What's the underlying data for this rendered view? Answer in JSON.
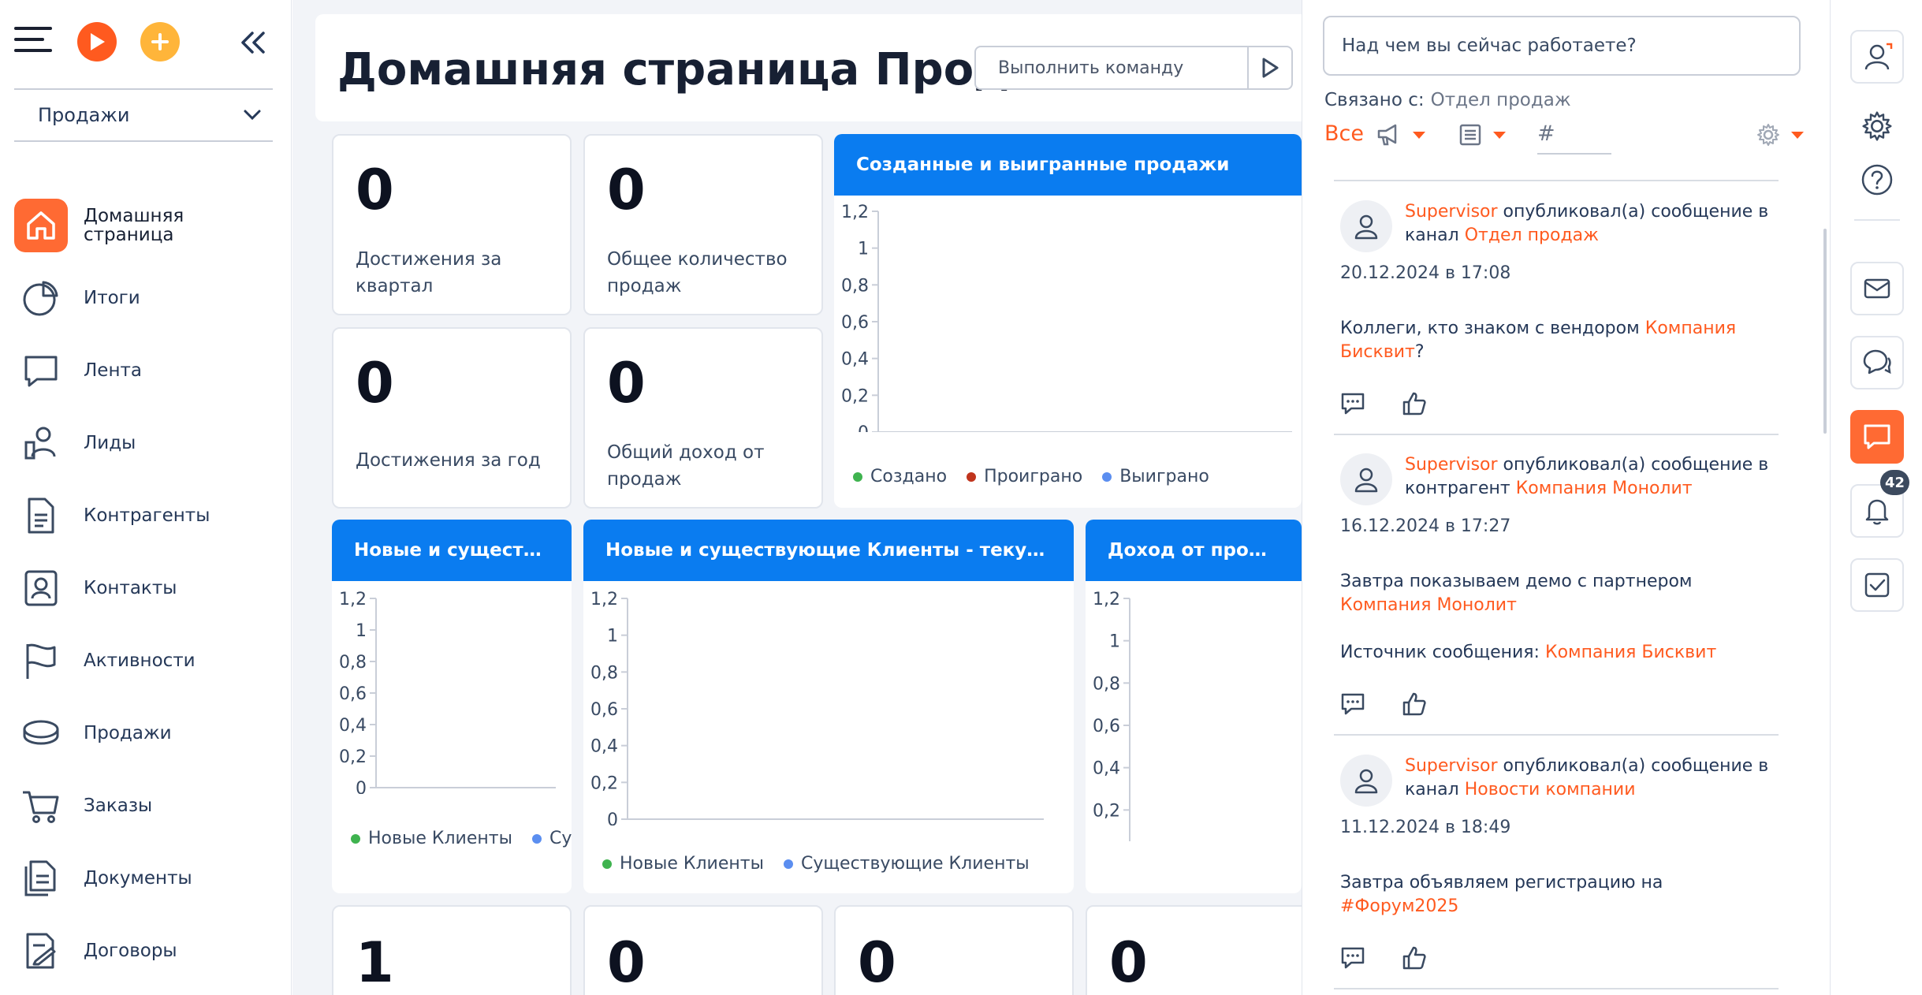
{
  "sidebar": {
    "workspace": "Продажи",
    "items": [
      {
        "label": "Домашняя страница",
        "icon": "home-icon",
        "active": true
      },
      {
        "label": "Итоги",
        "icon": "pie-chart-icon"
      },
      {
        "label": "Лента",
        "icon": "chat-bubble-icon"
      },
      {
        "label": "Лиды",
        "icon": "lead-icon"
      },
      {
        "label": "Контрагенты",
        "icon": "document-icon"
      },
      {
        "label": "Контакты",
        "icon": "contact-card-icon"
      },
      {
        "label": "Активности",
        "icon": "flag-icon"
      },
      {
        "label": "Продажи",
        "icon": "coin-icon"
      },
      {
        "label": "Заказы",
        "icon": "cart-icon"
      },
      {
        "label": "Документы",
        "icon": "documents-icon"
      },
      {
        "label": "Договоры",
        "icon": "contract-icon"
      }
    ]
  },
  "header": {
    "title": "Домашняя страница Продажи",
    "command_placeholder": "Выполнить команду"
  },
  "kpis": [
    {
      "value": "0",
      "label": "Достижения за квартал"
    },
    {
      "value": "0",
      "label": "Общее количество продаж"
    },
    {
      "value": "0",
      "label": "Достижения за год"
    },
    {
      "value": "0",
      "label": "Общий доход от продаж"
    }
  ],
  "bottom_kpis": [
    "1",
    "0",
    "0",
    "0"
  ],
  "charts": {
    "created_won": {
      "title": "Созданные и выигранные продажи",
      "legend": [
        {
          "name": "Создано",
          "color": "#3fb34f"
        },
        {
          "name": "Проиграно",
          "color": "#c0341d"
        },
        {
          "name": "Выиграно",
          "color": "#5b8ef0"
        }
      ]
    },
    "new_existing_short": {
      "title": "Новые и существую…",
      "legend": [
        {
          "name": "Новые Клиенты",
          "color": "#3fb34f"
        },
        {
          "name": "Существующие Клиент",
          "color": "#5b8ef0"
        }
      ]
    },
    "new_existing_year": {
      "title": "Новые и существующие Клиенты - текущий год",
      "legend": [
        {
          "name": "Новые Клиенты",
          "color": "#3fb34f"
        },
        {
          "name": "Существующие Клиенты",
          "color": "#5b8ef0"
        }
      ]
    },
    "revenue": {
      "title": "Доход от продаж в р…"
    }
  },
  "chart_data": {
    "type": "bar",
    "ylim": [
      0,
      1.2
    ],
    "y_ticks": [
      "1,2",
      "1",
      "0,8",
      "0,6",
      "0,4",
      "0,2",
      "0"
    ]
  },
  "feed": {
    "input_placeholder": "Над чем вы сейчас работаете?",
    "related_label": "Связано с:",
    "related_value": "Отдел продаж",
    "filter_all": "Все",
    "hash": "#",
    "posts": [
      {
        "author": "Supervisor",
        "action": " опубликовал(а) сообщение в канал ",
        "target": "Отдел продаж",
        "date": "20.12.2024 в 17:08",
        "text_before": "Коллеги, кто знаком с вендором ",
        "text_link": "Компания Бисквит",
        "text_after": "?"
      },
      {
        "author": "Supervisor",
        "action": " опубликовал(а) сообщение в контрагент ",
        "target": "Компания Монолит",
        "date": "16.12.2024 в 17:27",
        "text_before": "Завтра показываем демо с партнером ",
        "text_link": "Компания Монолит",
        "text_after": "",
        "source_label": "Источник сообщения: ",
        "source_link": "Компания Бисквит"
      },
      {
        "author": "Supervisor",
        "action": " опубликовал(а) сообщение в канал ",
        "target": "Новости компании",
        "date": "11.12.2024 в 18:49",
        "text_before": "Завтра объявляем регистрацию на ",
        "text_link": "#Форум2025",
        "text_after": ""
      }
    ]
  },
  "rail": {
    "notifications_count": "42"
  },
  "colors": {
    "accent": "#ff5a1f",
    "chart_header": "#0a7cf0",
    "add_button": "#ffb53a"
  }
}
